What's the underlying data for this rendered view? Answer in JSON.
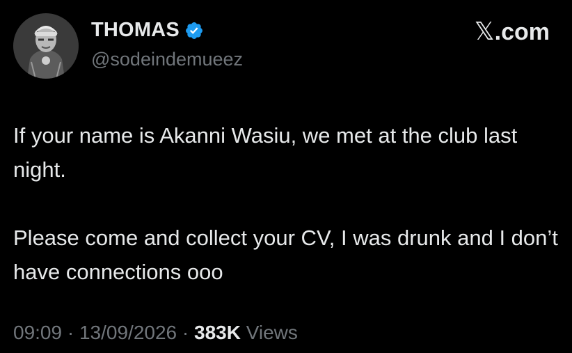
{
  "user": {
    "display_name": "THOMAS",
    "handle": "@sodeindemueez",
    "verified": true,
    "verified_color": "#1d9bf0"
  },
  "brand": {
    "x_glyph": "𝕏",
    "text": ".com"
  },
  "tweet": {
    "paragraphs": [
      "If your name is Akanni Wasiu, we met at the club last night.",
      "Please come and collect your CV, I was drunk and I don’t have connections ooo"
    ]
  },
  "meta": {
    "time": "09:09",
    "separator": "·",
    "date": "13/09/2026",
    "views_count": "383K",
    "views_label": "Views"
  },
  "colors": {
    "background": "#000000",
    "primary_text": "#e7e9ea",
    "secondary_text": "#71767b"
  }
}
